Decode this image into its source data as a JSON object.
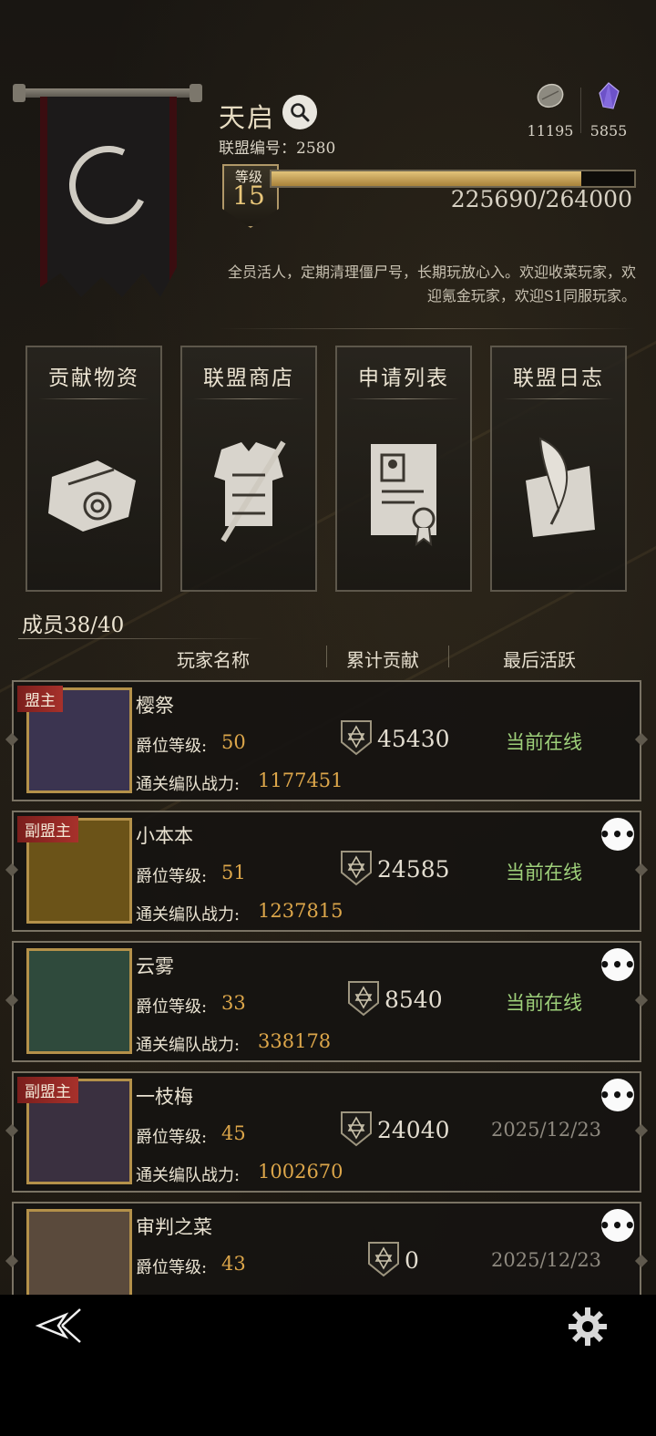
{
  "alliance": {
    "name": "天启",
    "id_label": "联盟编号：",
    "id_value": "2580",
    "level_label": "等级",
    "level": "15",
    "xp_text": "225690/264000",
    "xp_progress": 0.855,
    "notice": "全员活人，定期清理僵尸号，长期玩放心入。欢迎收菜玩家，欢迎氪金玩家，欢迎S1同服玩家。"
  },
  "currencies": [
    {
      "icon": "stone-coin-icon",
      "value": "11195"
    },
    {
      "icon": "purple-crystal-icon",
      "value": "5855"
    }
  ],
  "menu": [
    {
      "label": "贡献物资",
      "icon": "scroll-icon"
    },
    {
      "label": "联盟商店",
      "icon": "armor-sword-icon"
    },
    {
      "label": "申请列表",
      "icon": "document-seal-icon"
    },
    {
      "label": "联盟日志",
      "icon": "quill-paper-icon"
    }
  ],
  "members": {
    "count_text": "成员38/40",
    "columns": [
      "玩家名称",
      "累计贡献",
      "最后活跃"
    ],
    "rank_label": "爵位等级:",
    "power_label": "通关编队战力:",
    "rows": [
      {
        "tag": "盟主",
        "name": "樱祭",
        "rank": "50",
        "power": "1177451",
        "contribution": "45430",
        "last_active": "当前在线",
        "online": true
      },
      {
        "tag": "副盟主",
        "name": "小本本",
        "rank": "51",
        "power": "1237815",
        "contribution": "24585",
        "last_active": "当前在线",
        "online": true
      },
      {
        "tag": "",
        "name": "云雾",
        "rank": "33",
        "power": "338178",
        "contribution": "8540",
        "last_active": "当前在线",
        "online": true
      },
      {
        "tag": "副盟主",
        "name": "一枝梅",
        "rank": "45",
        "power": "1002670",
        "contribution": "24040",
        "last_active": "2025/12/23",
        "online": false
      },
      {
        "tag": "",
        "name": "审判之菜",
        "rank": "43",
        "power": "",
        "contribution": "0",
        "last_active": "2025/12/23",
        "online": false
      }
    ]
  },
  "more_label": "•••",
  "bottom": {
    "back_icon": "back-arrow-icon",
    "settings_icon": "gear-icon"
  }
}
